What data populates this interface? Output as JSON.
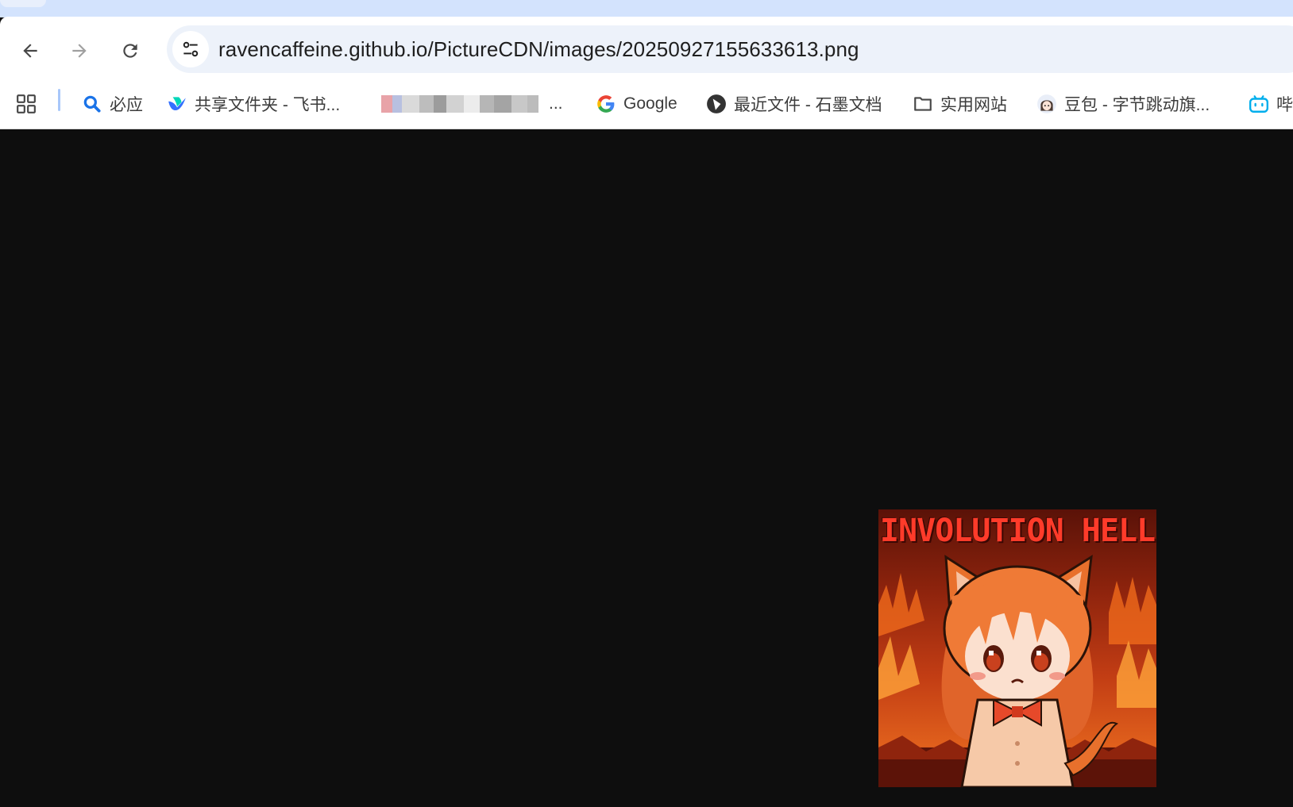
{
  "toolbar": {
    "url": "ravencaffeine.github.io/PictureCDN/images/20250927155633613.png",
    "back_icon": "arrow-left-icon",
    "forward_icon": "arrow-right-icon",
    "reload_icon": "reload-icon",
    "site_info_icon": "tune-icon"
  },
  "bookmarks": {
    "apps_icon": "apps-grid-icon",
    "items": [
      {
        "label": "必应",
        "icon": "search-icon",
        "color": "#1a73e8"
      },
      {
        "label": "共享文件夹 - 飞书...",
        "icon": "feishu-icon",
        "color": "#3370ff"
      },
      {
        "label": "...",
        "icon": "blurred-favicon",
        "redacted": true
      },
      {
        "label": "Google",
        "icon": "google-g-icon"
      },
      {
        "label": "最近文件 - 石墨文档",
        "icon": "shimo-icon",
        "color": "#333333"
      },
      {
        "label": "实用网站",
        "icon": "folder-icon"
      },
      {
        "label": "豆包 - 字节跳动旗...",
        "icon": "doubao-avatar-icon"
      },
      {
        "label": "哔",
        "icon": "bilibili-icon",
        "color": "#00aeec"
      }
    ]
  },
  "content": {
    "background": "#0e0e0e",
    "image_title": "INVOLUTION HELL"
  }
}
